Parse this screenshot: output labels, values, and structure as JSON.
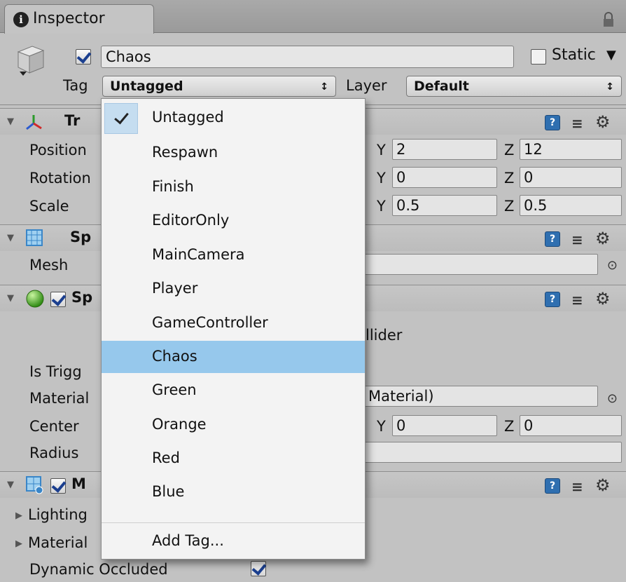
{
  "window": {
    "tab_title": "Inspector"
  },
  "header": {
    "object_name": "Chaos",
    "static_label": "Static",
    "tag_label": "Tag",
    "tag_value": "Untagged",
    "layer_label": "Layer",
    "layer_value": "Default",
    "arrows": "↕"
  },
  "transform": {
    "title_partial": "Tr",
    "rows": [
      {
        "label": "Position",
        "y": "2",
        "z": "12"
      },
      {
        "label": "Rotation",
        "y": "0",
        "z": "0"
      },
      {
        "label": "Scale",
        "y": "0.5",
        "z": "0.5"
      }
    ],
    "axis_y": "Y",
    "axis_z": "Z"
  },
  "mesh_filter": {
    "title_partial": "Sp",
    "mesh_label": "Mesh"
  },
  "sphere_collider": {
    "title_partial": "Sp",
    "edit_text": "llider",
    "is_trigger_label": "Is Trigg",
    "material_label": "Material",
    "material_value": "Material)",
    "center_label": "Center",
    "center_y": "0",
    "center_z": "0",
    "radius_label": "Radius"
  },
  "mesh_renderer": {
    "title_partial": "M",
    "lighting_label": "Lighting",
    "materials_label": "Material",
    "dynamic_occluded_label": "Dynamic Occluded"
  },
  "tag_menu": {
    "items": [
      "Untagged",
      "Respawn",
      "Finish",
      "EditorOnly",
      "MainCamera",
      "Player",
      "GameController",
      "Chaos",
      "Green",
      "Orange",
      "Red",
      "Blue"
    ],
    "checked": "Untagged",
    "highlighted": "Chaos",
    "add_tag": "Add Tag..."
  },
  "icons": {
    "help": "?",
    "gear": "⚙",
    "sliders": "≡",
    "target": "⊙"
  },
  "colors": {
    "highlight": "#96c8ec",
    "panel": "#c2c2c2",
    "help_blue": "#2f6fb0"
  }
}
